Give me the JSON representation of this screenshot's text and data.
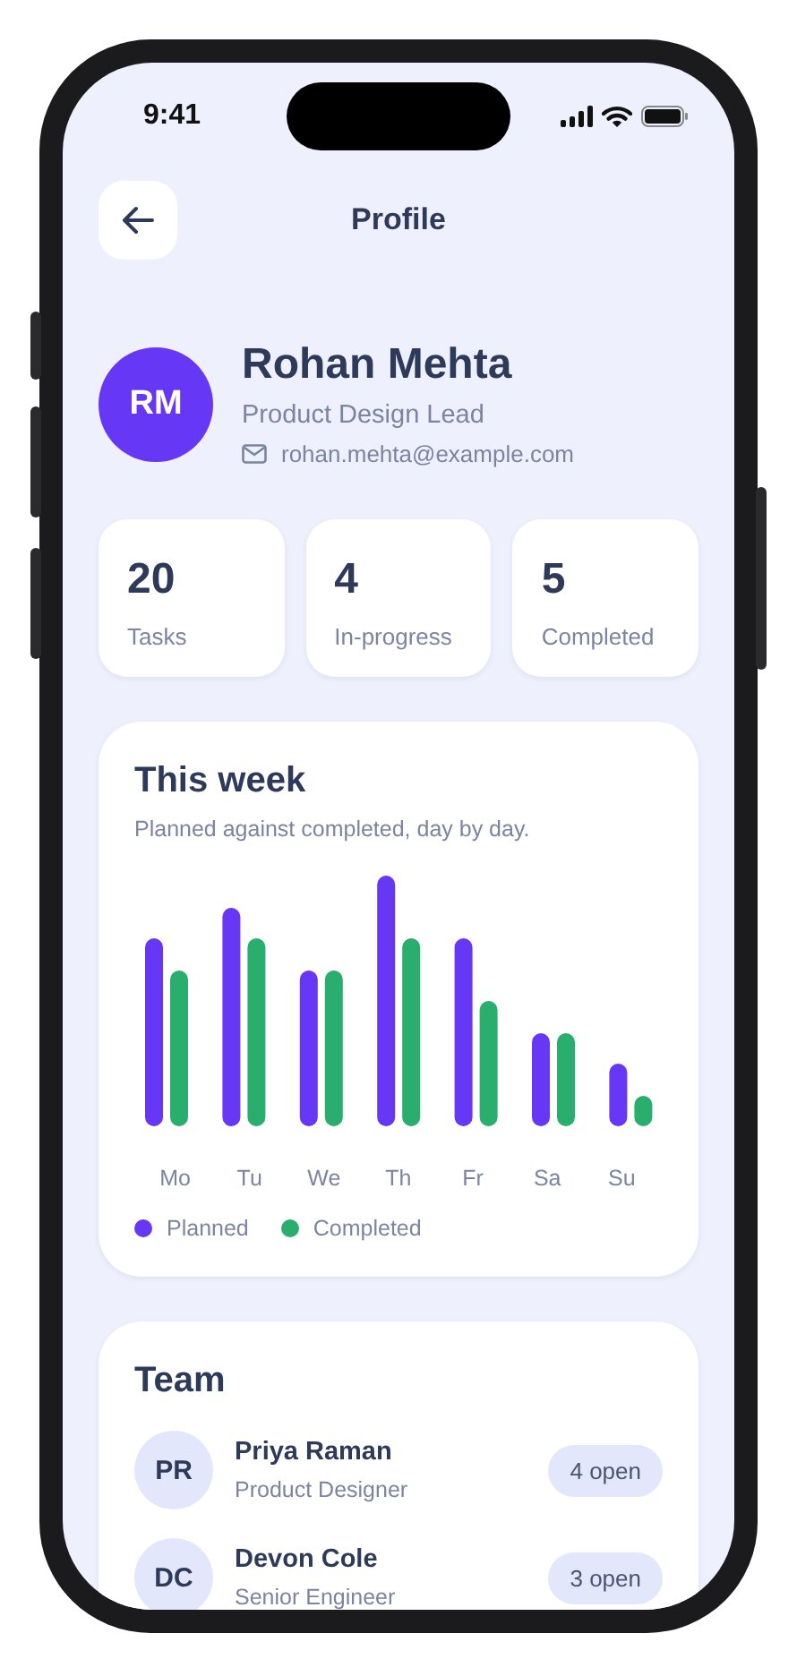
{
  "status_bar": {
    "time": "9:41"
  },
  "header": {
    "title": "Profile"
  },
  "profile": {
    "initials": "RM",
    "name": "Rohan Mehta",
    "role": "Product Design Lead",
    "email": "rohan.mehta@example.com"
  },
  "stats": [
    {
      "value": "20",
      "label": "Tasks"
    },
    {
      "value": "4",
      "label": "In-progress"
    },
    {
      "value": "5",
      "label": "Completed"
    }
  ],
  "week_card": {
    "title": "This week",
    "subtitle": "Planned against completed, day by day.",
    "days": [
      "Mo",
      "Tu",
      "We",
      "Th",
      "Fr",
      "Sa",
      "Su"
    ],
    "legend": [
      {
        "label": "Planned",
        "color": "#6638f5"
      },
      {
        "label": "Completed",
        "color": "#2aae6e"
      }
    ]
  },
  "team": {
    "title": "Team",
    "members": [
      {
        "initials": "PR",
        "name": "Priya Raman",
        "role": "Product Designer",
        "badge": "4 open"
      },
      {
        "initials": "DC",
        "name": "Devon Cole",
        "role": "Senior Engineer",
        "badge": "3 open"
      }
    ]
  }
}
